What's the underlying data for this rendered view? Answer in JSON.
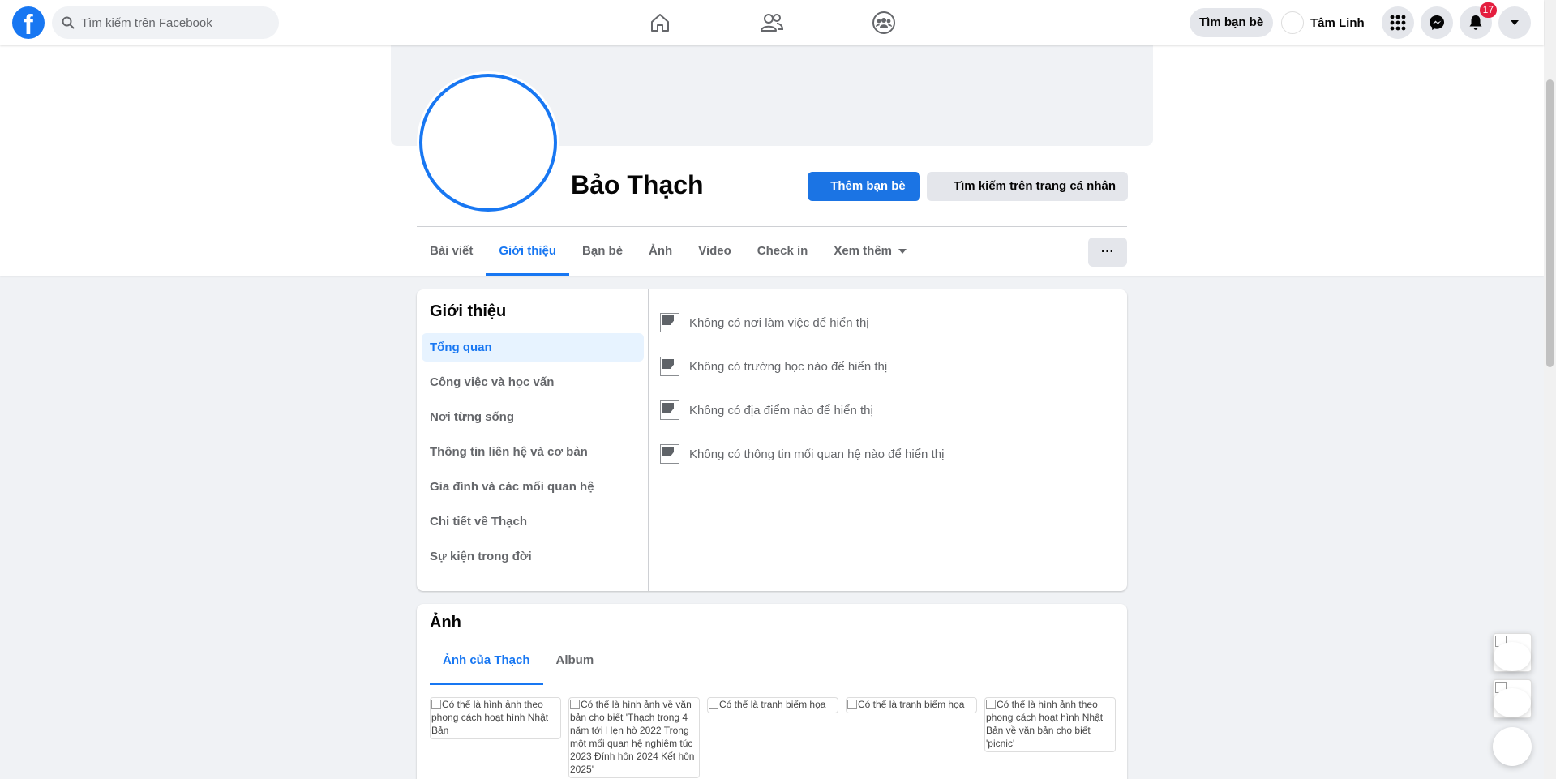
{
  "topbar": {
    "logo": "f",
    "search_placeholder": "Tìm kiếm trên Facebook",
    "nav_icons": [
      "home-icon",
      "friends-icon",
      "groups-icon"
    ],
    "find_friends_label": "Tìm bạn bè",
    "user_name": "Tâm Linh",
    "notification_count": "17",
    "accent": "#1877f2"
  },
  "profile": {
    "name": "Bảo Thạch",
    "add_friend_label": "Thêm bạn bè",
    "search_profile_label": "Tìm kiếm trên trang cá nhân",
    "tabs": [
      {
        "label": "Bài viết"
      },
      {
        "label": "Giới thiệu",
        "active": true
      },
      {
        "label": "Bạn bè"
      },
      {
        "label": "Ảnh"
      },
      {
        "label": "Video"
      },
      {
        "label": "Check in"
      },
      {
        "label": "Xem thêm"
      }
    ],
    "more_label": "···"
  },
  "intro": {
    "title": "Giới thiệu",
    "menu": [
      {
        "label": "Tổng quan",
        "active": true
      },
      {
        "label": "Công việc và học vấn"
      },
      {
        "label": "Nơi từng sống"
      },
      {
        "label": "Thông tin liên hệ và cơ bản"
      },
      {
        "label": "Gia đình và các mối quan hệ"
      },
      {
        "label": "Chi tiết về Thạch"
      },
      {
        "label": "Sự kiện trong đời"
      }
    ],
    "rows": [
      "Không có nơi làm việc để hiển thị",
      "Không có trường học nào để hiển thị",
      "Không có địa điểm nào để hiển thị",
      "Không có thông tin mối quan hệ nào để hiển thị"
    ]
  },
  "photos": {
    "title": "Ảnh",
    "tabs": [
      {
        "label": "Ảnh của Thạch",
        "active": true
      },
      {
        "label": "Album"
      }
    ],
    "items": [
      "Có thể là hình ảnh theo phong cách hoạt hình Nhật Bản",
      "Có thể là hình ảnh về văn bản cho biết 'Thạch trong 4 năm tới Hẹn hò 2022 Trong một mối quan hệ nghiêm túc 2023 Đính hôn 2024 Kết hôn 2025'",
      "Có thể là tranh biếm họa",
      "Có thể là tranh biếm họa",
      "Có thể là hình ảnh theo phong cách hoạt hình Nhật Bản về văn bản cho biết 'picnic'"
    ]
  }
}
